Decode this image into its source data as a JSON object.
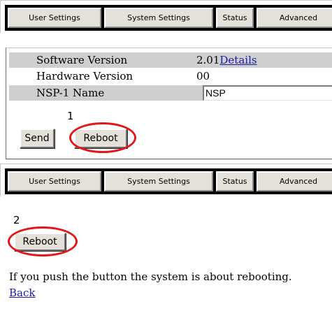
{
  "tabs_top": [
    {
      "label": "User Settings"
    },
    {
      "label": "System Settings"
    },
    {
      "label": "Status"
    },
    {
      "label": "Advanced"
    }
  ],
  "info": {
    "software_label": "Software Version",
    "software_value": "2.01",
    "details_link": "Details",
    "hardware_label": "Hardware Version",
    "hardware_value": "00",
    "name_label": "NSP-1 Name",
    "name_value": "NSP"
  },
  "step1": {
    "number": "1",
    "send_label": "Send",
    "reboot_label": "Reboot"
  },
  "tabs_bottom": [
    {
      "label": "User Settings"
    },
    {
      "label": "System Settings"
    },
    {
      "label": "Status"
    },
    {
      "label": "Advanced"
    }
  ],
  "step2": {
    "number": "2",
    "reboot_label": "Reboot"
  },
  "message": "If you push the button the system is about rebooting.",
  "back_link": "Back",
  "colors": {
    "highlight_ring": "#e01818",
    "button_face": "#e4e1da",
    "row_shade": "#cfcfcf",
    "link": "#1a1aa6"
  }
}
